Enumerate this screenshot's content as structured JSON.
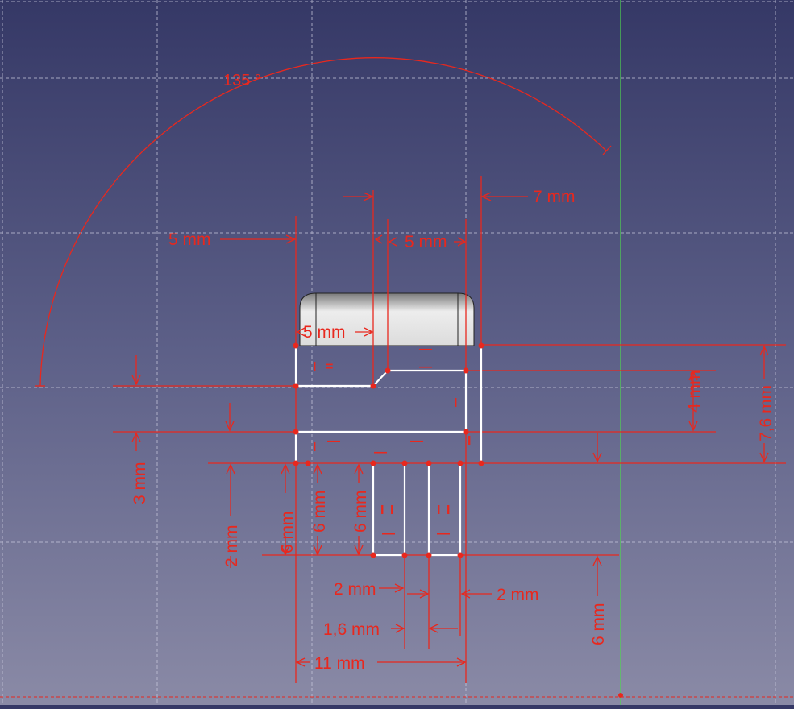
{
  "colors": {
    "grid": "#c8c8dc",
    "dimension": "#e8281e",
    "geometry": "#ffffff",
    "axis_y": "#4ed84e",
    "pad_highlight": "#f2f2f2",
    "pad_shadow": "#8a8a8a"
  },
  "dimensions": {
    "angle": "135 °",
    "d_top_left_5mm": "5 mm",
    "d_top_mid_5mm": "5 mm",
    "d_top_right_7mm": "7 mm",
    "d_inner_5mm": "5 mm",
    "d_right_4mm": "4 mm",
    "d_right_7_6mm": "7,6 mm",
    "d_left_3mm": "3 mm",
    "d_left_2mm": "2 mm",
    "d_v_6mm_a": "6 mm",
    "d_v_6mm_b": "6 mm",
    "d_v_6mm_c": "6 mm",
    "d_bottom_2mm_a": "2 mm",
    "d_bottom_2mm_b": "2 mm",
    "d_bottom_1_6mm": "1,6 mm",
    "d_bottom_11mm": "11 mm",
    "d_right_6mm": "6 mm"
  },
  "constraint_marks": {
    "vertical": "I",
    "horizontal": "—",
    "equal": "="
  }
}
